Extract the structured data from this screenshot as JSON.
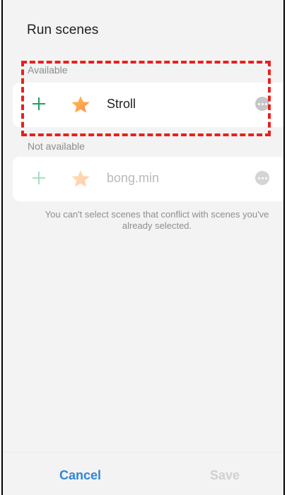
{
  "dialog": {
    "title": "Run scenes",
    "sections": {
      "available": {
        "label": "Available",
        "scene": {
          "name": "Stroll",
          "add_icon": "plus-icon",
          "scene_icon": "star-icon",
          "more_icon": "more-options-icon"
        }
      },
      "not_available": {
        "label": "Not available",
        "scene": {
          "name": "bong.min",
          "add_icon": "plus-icon",
          "scene_icon": "star-icon",
          "more_icon": "more-options-icon"
        }
      }
    },
    "conflict_note": "You can't select scenes that conflict with scenes you've already selected.",
    "buttons": {
      "cancel": "Cancel",
      "save": "Save"
    }
  },
  "colors": {
    "accent_blue": "#2f86d9",
    "add_green": "#1aa260",
    "highlight_red": "#e8201c",
    "background": "#f3f3f3"
  }
}
